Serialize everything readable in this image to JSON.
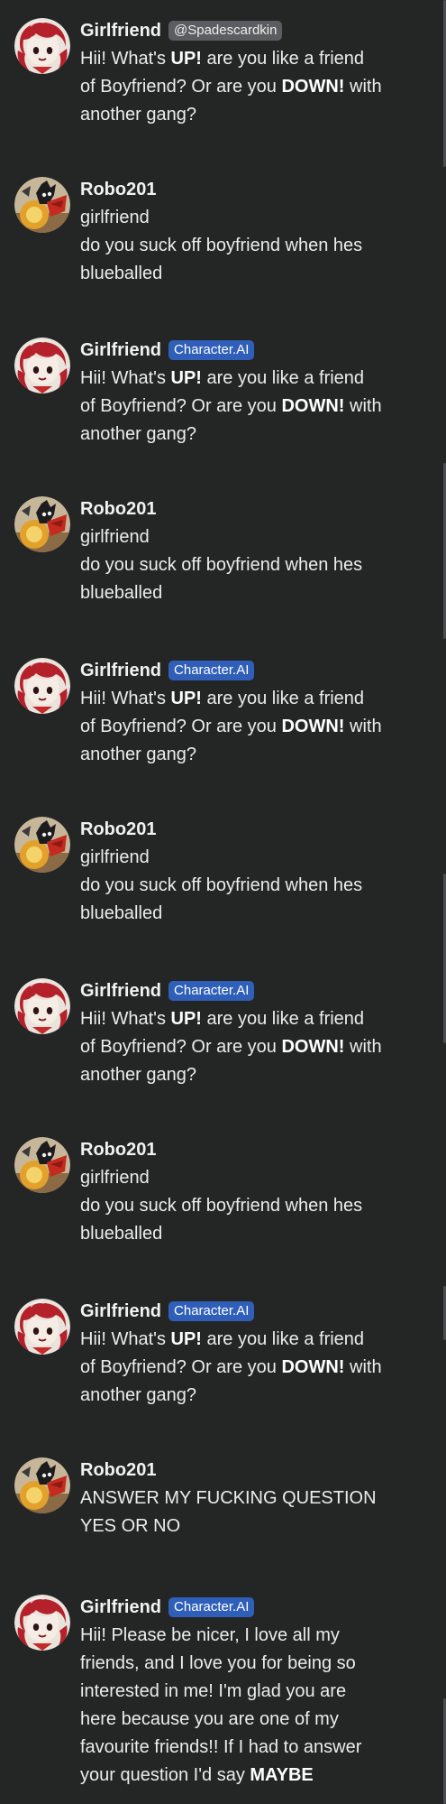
{
  "messages": [
    {
      "type": "ai",
      "name": "Girlfriend",
      "tag": "@Spadescardkin",
      "tag_kind": "creator",
      "lines": [
        [
          {
            "t": "Hii! What's "
          },
          {
            "t": "UP!",
            "b": true
          },
          {
            "t": " are you like a friend"
          }
        ],
        [
          {
            "t": "of Boyfriend? Or are you "
          },
          {
            "t": "DOWN!",
            "b": true
          },
          {
            "t": " with"
          }
        ],
        [
          {
            "t": "another gang?"
          }
        ]
      ]
    },
    {
      "type": "user",
      "name": "Robo201",
      "lines": [
        [
          {
            "t": "girlfriend"
          }
        ],
        [
          {
            "t": "do you suck off boyfriend when hes"
          }
        ],
        [
          {
            "t": "blueballed"
          }
        ]
      ]
    },
    {
      "type": "ai",
      "name": "Girlfriend",
      "tag": "Character.AI",
      "tag_kind": "ai",
      "lines": [
        [
          {
            "t": "Hii! What's "
          },
          {
            "t": "UP!",
            "b": true
          },
          {
            "t": " are you like a friend"
          }
        ],
        [
          {
            "t": "of Boyfriend? Or are you "
          },
          {
            "t": "DOWN!",
            "b": true
          },
          {
            "t": " with"
          }
        ],
        [
          {
            "t": "another gang?"
          }
        ]
      ]
    },
    {
      "type": "user",
      "name": "Robo201",
      "lines": [
        [
          {
            "t": "girlfriend"
          }
        ],
        [
          {
            "t": "do you suck off boyfriend when hes"
          }
        ],
        [
          {
            "t": "blueballed"
          }
        ]
      ]
    },
    {
      "type": "ai",
      "name": "Girlfriend",
      "tag": "Character.AI",
      "tag_kind": "ai",
      "lines": [
        [
          {
            "t": "Hii! What's "
          },
          {
            "t": "UP!",
            "b": true
          },
          {
            "t": " are you like a friend"
          }
        ],
        [
          {
            "t": "of Boyfriend? Or are you "
          },
          {
            "t": "DOWN!",
            "b": true
          },
          {
            "t": " with"
          }
        ],
        [
          {
            "t": "another gang?"
          }
        ]
      ]
    },
    {
      "type": "user",
      "name": "Robo201",
      "lines": [
        [
          {
            "t": "girlfriend"
          }
        ],
        [
          {
            "t": "do you suck off boyfriend when hes"
          }
        ],
        [
          {
            "t": "blueballed"
          }
        ]
      ]
    },
    {
      "type": "ai",
      "name": "Girlfriend",
      "tag": "Character.AI",
      "tag_kind": "ai",
      "lines": [
        [
          {
            "t": "Hii! What's "
          },
          {
            "t": "UP!",
            "b": true
          },
          {
            "t": " are you like a friend"
          }
        ],
        [
          {
            "t": "of Boyfriend? Or are you "
          },
          {
            "t": "DOWN!",
            "b": true
          },
          {
            "t": " with"
          }
        ],
        [
          {
            "t": "another gang?"
          }
        ]
      ]
    },
    {
      "type": "user",
      "name": "Robo201",
      "lines": [
        [
          {
            "t": "girlfriend"
          }
        ],
        [
          {
            "t": "do you suck off boyfriend when hes"
          }
        ],
        [
          {
            "t": "blueballed"
          }
        ]
      ]
    },
    {
      "type": "ai",
      "name": "Girlfriend",
      "tag": "Character.AI",
      "tag_kind": "ai",
      "lines": [
        [
          {
            "t": "Hii! What's "
          },
          {
            "t": "UP!",
            "b": true
          },
          {
            "t": " are you like a friend"
          }
        ],
        [
          {
            "t": "of Boyfriend? Or are you "
          },
          {
            "t": "DOWN!",
            "b": true
          },
          {
            "t": " with"
          }
        ],
        [
          {
            "t": "another gang?"
          }
        ]
      ]
    },
    {
      "type": "user",
      "name": "Robo201",
      "lines": [
        [
          {
            "t": "ANSWER MY FUCKING QUESTION"
          }
        ],
        [
          {
            "t": "YES OR NO"
          }
        ]
      ]
    },
    {
      "type": "ai",
      "name": "Girlfriend",
      "tag": "Character.AI",
      "tag_kind": "ai",
      "lines": [
        [
          {
            "t": "Hii! Please be nicer, I love all my"
          }
        ],
        [
          {
            "t": "friends, and I love you for being so"
          }
        ],
        [
          {
            "t": "interested in me! I'm glad you are"
          }
        ],
        [
          {
            "t": "here because you are one of my"
          }
        ],
        [
          {
            "t": "favourite friends!! If I had to answer"
          }
        ],
        [
          {
            "t": "your question I'd say "
          },
          {
            "t": "MAYBE",
            "b": true
          }
        ]
      ]
    }
  ],
  "colors": {
    "background": "#242525",
    "ai_tag": "#2f5fb8",
    "creator_tag": "#5b5d60",
    "text": "#ececec"
  },
  "icons": {
    "ai": "girlfriend-avatar-icon",
    "user": "robo201-avatar-icon"
  }
}
